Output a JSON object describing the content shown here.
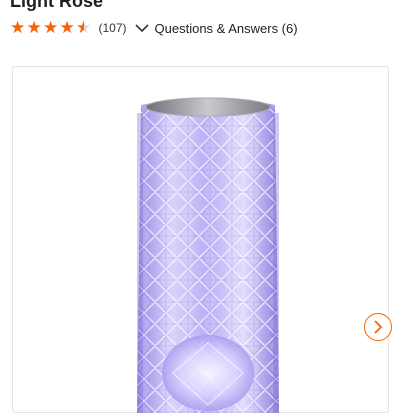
{
  "product": {
    "title": "Light Rose"
  },
  "rating": {
    "stars": 4.5,
    "max_stars": 5,
    "count_label": "(107)",
    "star_color": "#f96302",
    "empty_star_color": "#dcdcdc"
  },
  "qa": {
    "label": "Questions & Answers (6)"
  },
  "gallery": {
    "image_name": "crystal-rose-lamp-image",
    "next_icon": "chevron-right-icon",
    "accent_color": "#f96302"
  }
}
